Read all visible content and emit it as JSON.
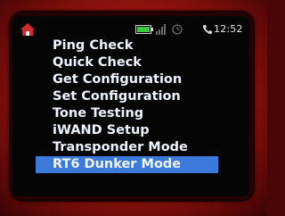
{
  "status_bar": {
    "time": "12:52",
    "icons": [
      "home-icon",
      "battery-icon",
      "signal-icon",
      "clock-icon",
      "phone-icon"
    ]
  },
  "menu": {
    "items": [
      {
        "label": "Ping Check"
      },
      {
        "label": "Quick Check"
      },
      {
        "label": "Get Configuration"
      },
      {
        "label": "Set Configuration"
      },
      {
        "label": "Tone Testing"
      },
      {
        "label": "iWAND Setup"
      },
      {
        "label": "Transponder Mode"
      },
      {
        "label": "RT6 Dunker Mode"
      }
    ],
    "selected_index": 7
  },
  "colors": {
    "screen_background": "#050505",
    "text": "#eef4ff",
    "selection_highlight": "#3b7ad9",
    "casing": "#a3170f"
  }
}
